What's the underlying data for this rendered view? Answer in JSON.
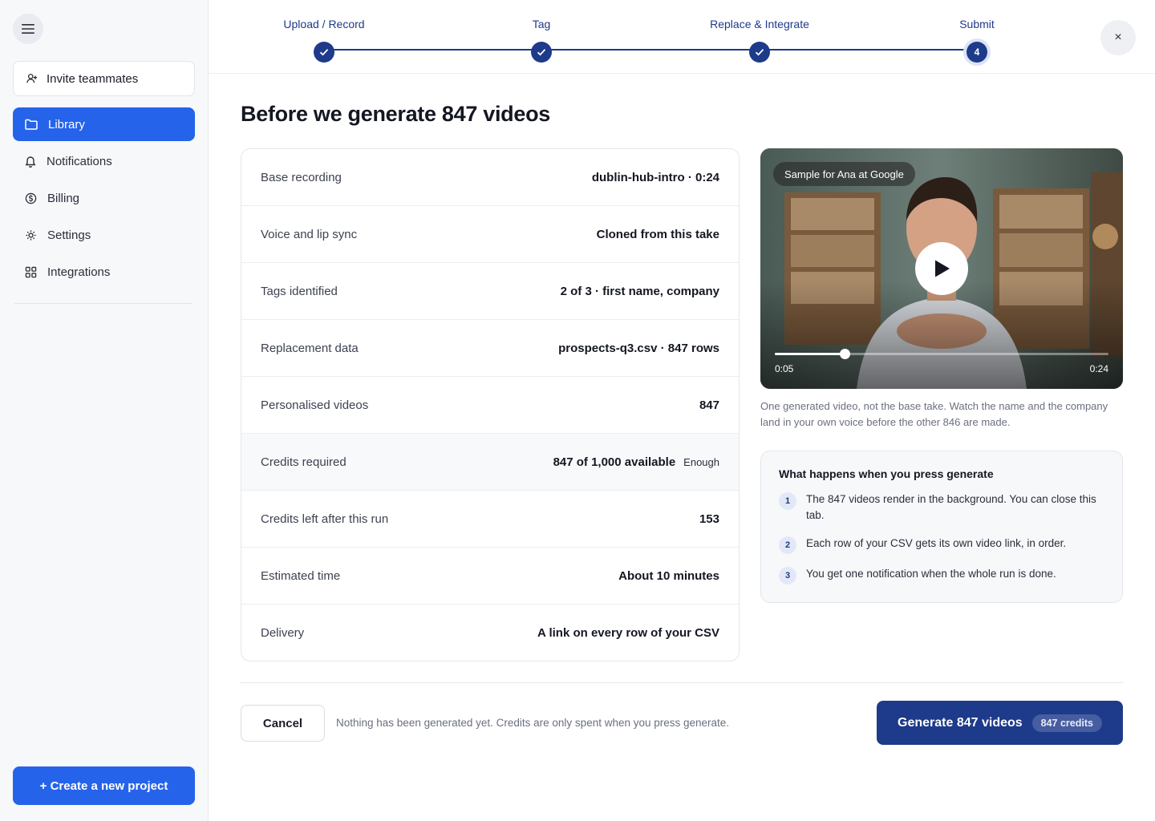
{
  "sidebar": {
    "menu_icon": "hamburger-icon",
    "invite_label": "Invite teammates",
    "nav": [
      {
        "label": "Library",
        "icon": "folder-icon",
        "active": true
      },
      {
        "label": "Notifications",
        "icon": "bell-icon",
        "active": false
      },
      {
        "label": "Billing",
        "icon": "dollar-icon",
        "active": false
      },
      {
        "label": "Settings",
        "icon": "gear-icon",
        "active": false
      },
      {
        "label": "Integrations",
        "icon": "grid-icon",
        "active": false
      }
    ],
    "create_label": "+ Create a new project"
  },
  "stepper": {
    "steps": [
      {
        "label": "Upload / Record",
        "state": "done"
      },
      {
        "label": "Tag",
        "state": "done"
      },
      {
        "label": "Replace & Integrate",
        "state": "done"
      },
      {
        "label": "Submit",
        "state": "current",
        "number": "4"
      }
    ],
    "close_label": "×"
  },
  "main": {
    "title": "Before we generate 847 videos",
    "summary": [
      {
        "label": "Base recording",
        "value": "dublin-hub-intro · 0:24"
      },
      {
        "label": "Voice and lip sync",
        "value": "Cloned from this take"
      },
      {
        "label": "Tags identified",
        "value": "2 of 3 · first name, company"
      },
      {
        "label": "Replacement data",
        "value": "prospects-q3.csv · 847 rows"
      },
      {
        "label": "Personalised videos",
        "value": "847"
      },
      {
        "label": "Credits required",
        "value": "847 of 1,000 available",
        "badge": "Enough"
      },
      {
        "label": "Credits left after this run",
        "value": "153"
      },
      {
        "label": "Estimated time",
        "value": "About 10 minutes"
      },
      {
        "label": "Delivery",
        "value": "A link on every row of your CSV"
      }
    ]
  },
  "video": {
    "tag": "Sample for Ana at Google",
    "current_time": "0:05",
    "duration": "0:24",
    "progress_fraction": 0.2083,
    "caption": "One generated video, not the base take. Watch the name and the company land in your own voice before the other 846 are made."
  },
  "info": {
    "title": "What happens when you press generate",
    "items": [
      {
        "num": "1",
        "text": "The 847 videos render in the background. You can close this tab."
      },
      {
        "num": "2",
        "text": "Each row of your CSV gets its own video link, in order."
      },
      {
        "num": "3",
        "text": "You get one notification when the whole run is done."
      }
    ]
  },
  "footer": {
    "cancel_label": "Cancel",
    "note": "Nothing has been generated yet. Credits are only spent when you press generate.",
    "generate_label": "Generate 847 videos",
    "credits_label": "847 credits"
  },
  "colors": {
    "accent": "#2563eb",
    "navy": "#1e3a8a"
  }
}
